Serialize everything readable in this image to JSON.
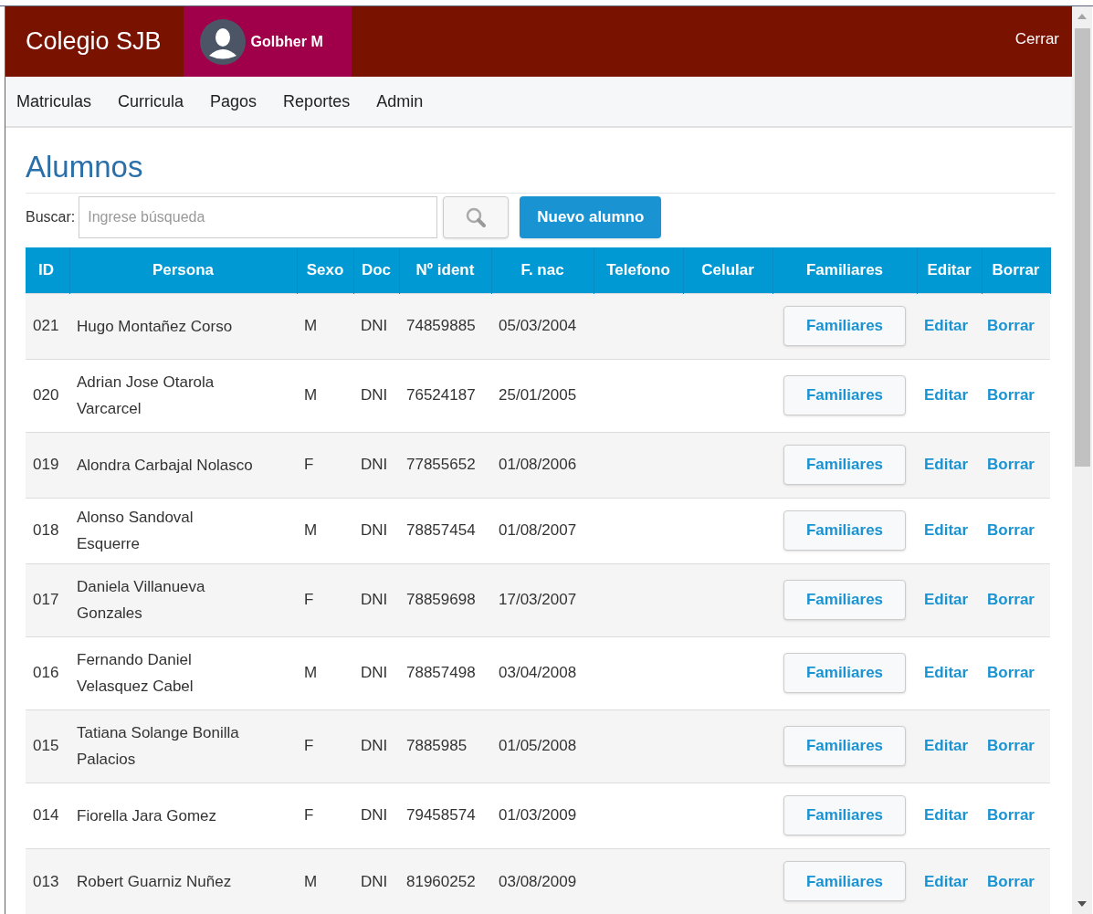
{
  "header": {
    "brand": "Colegio SJB",
    "user": "Golbher M",
    "logout": "Cerrar"
  },
  "nav": [
    "Matriculas",
    "Curricula",
    "Pagos",
    "Reportes",
    "Admin"
  ],
  "page": {
    "title": "Alumnos",
    "search_label": "Buscar:",
    "search_placeholder": "Ingrese búsqueda",
    "new_button": "Nuevo alumno"
  },
  "table": {
    "columns": [
      "ID",
      "Persona",
      "Sexo",
      "Doc",
      "Nº ident",
      "F. nac",
      "Telefono",
      "Celular",
      "Familiares",
      "Editar",
      "Borrar"
    ],
    "rows": [
      {
        "id": "021",
        "name": "Hugo Montañez Corso",
        "sex": "M",
        "doc": "DNI",
        "ident": "74859885",
        "birth": "05/03/2004",
        "family": "Familiares",
        "edit": "Editar",
        "delete": "Borrar"
      },
      {
        "id": "020",
        "name": "Adrian Jose Otarola Varcarcel",
        "sex": "M",
        "doc": "DNI",
        "ident": "76524187",
        "birth": "25/01/2005",
        "family": "Familiares",
        "edit": "Editar",
        "delete": "Borrar"
      },
      {
        "id": "019",
        "name": "Alondra Carbajal Nolasco",
        "sex": "F",
        "doc": "DNI",
        "ident": "77855652",
        "birth": "01/08/2006",
        "family": "Familiares",
        "edit": "Editar",
        "delete": "Borrar"
      },
      {
        "id": "018",
        "name": "Alonso Sandoval Esquerre",
        "sex": "M",
        "doc": "DNI",
        "ident": "78857454",
        "birth": "01/08/2007",
        "family": "Familiares",
        "edit": "Editar",
        "delete": "Borrar"
      },
      {
        "id": "017",
        "name": "Daniela Villanueva Gonzales",
        "sex": "F",
        "doc": "DNI",
        "ident": "78859698",
        "birth": "17/03/2007",
        "family": "Familiares",
        "edit": "Editar",
        "delete": "Borrar"
      },
      {
        "id": "016",
        "name": "Fernando Daniel Velasquez Cabel",
        "sex": "M",
        "doc": "DNI",
        "ident": "78857498",
        "birth": "03/04/2008",
        "family": "Familiares",
        "edit": "Editar",
        "delete": "Borrar"
      },
      {
        "id": "015",
        "name": "Tatiana Solange Bonilla Palacios",
        "sex": "F",
        "doc": "DNI",
        "ident": "7885985",
        "birth": "01/05/2008",
        "family": "Familiares",
        "edit": "Editar",
        "delete": "Borrar"
      },
      {
        "id": "014",
        "name": "Fiorella Jara Gomez",
        "sex": "F",
        "doc": "DNI",
        "ident": "79458574",
        "birth": "01/03/2009",
        "family": "Familiares",
        "edit": "Editar",
        "delete": "Borrar"
      },
      {
        "id": "013",
        "name": "Robert Guarniz Nuñez",
        "sex": "M",
        "doc": "DNI",
        "ident": "81960252",
        "birth": "03/08/2009",
        "family": "Familiares",
        "edit": "Editar",
        "delete": "Borrar"
      }
    ]
  }
}
